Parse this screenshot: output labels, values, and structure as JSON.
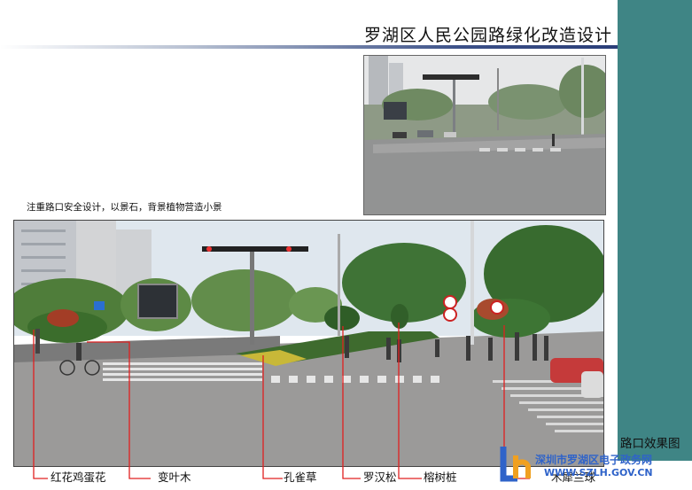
{
  "header": {
    "title": "罗湖区人民公园路绿化改造设计"
  },
  "photos": {
    "top": {
      "description_name": "intersection-before-photo"
    },
    "main": {
      "description_name": "intersection-after-rendering"
    }
  },
  "note": "注重路口安全设计，以景石，背景植物营造小景",
  "view_label": "路口效果图",
  "callouts": [
    {
      "key": "red_egg_flower",
      "label": "红花鸡蛋花"
    },
    {
      "key": "croton",
      "label": "变叶木"
    },
    {
      "key": "peacock_grass",
      "label": "孔雀草"
    },
    {
      "key": "podocarpus",
      "label": "罗汉松"
    },
    {
      "key": "banyan_stump",
      "label": "榕树桩"
    },
    {
      "key": "magnolia_ball",
      "label": "木犀兰球"
    }
  ],
  "watermark": {
    "line1": "深圳市罗湖区电子政务网",
    "line2": "WWW.SZLH.GOV.CN"
  },
  "colors": {
    "teal_bar": "#3f8585",
    "callout_line": "#e02020",
    "watermark": "#2f63c9"
  }
}
